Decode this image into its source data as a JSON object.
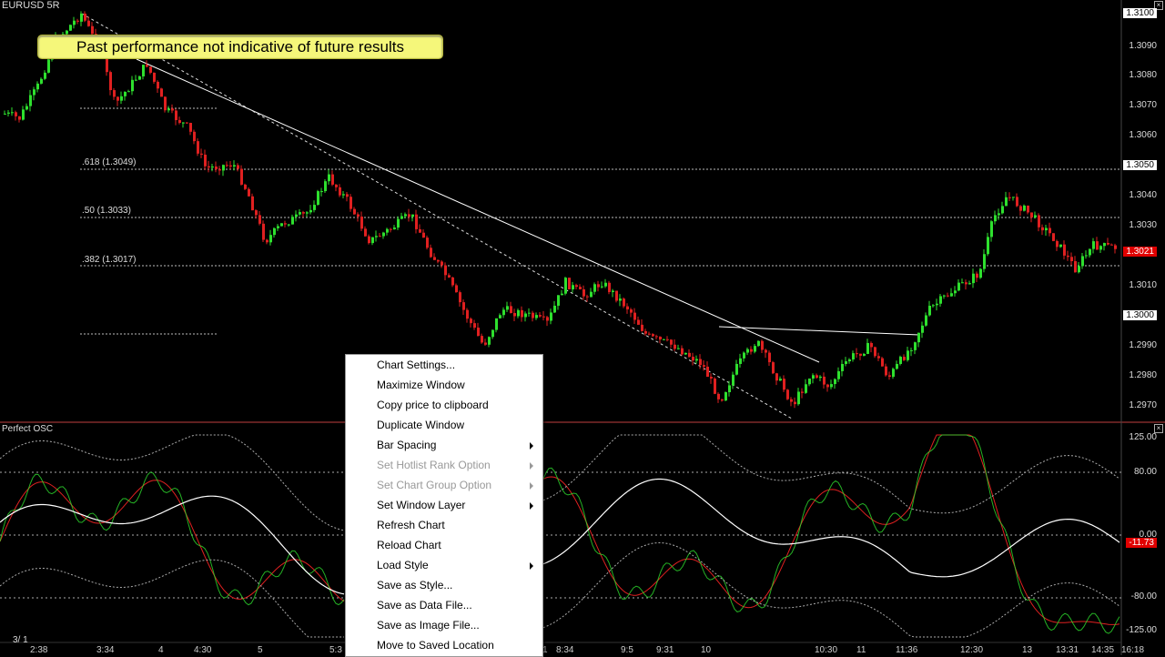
{
  "window": {
    "price_title": "EURUSD 5R",
    "osc_title": "Perfect OSC",
    "page_indicator": "3/ 1"
  },
  "banner": {
    "text": "Past performance not indicative of future results"
  },
  "fib_labels": [
    ".618 (1.3049)",
    ".50 (1.3033)",
    ".382 (1.3017)"
  ],
  "price_axis": [
    "1.3090",
    "1.3080",
    "1.3070",
    "1.3060",
    "1.3040",
    "1.3030",
    "1.3010",
    "1.2990",
    "1.2980",
    "1.2970"
  ],
  "price_boxes": [
    "1.3100",
    "1.3050",
    "1.3000"
  ],
  "last_price": "1.3021",
  "osc_axis": [
    "125.00",
    "80.00",
    "0.00",
    "-80.00",
    "-125.00"
  ],
  "osc_last": "-11.73",
  "time_axis": [
    "2:38",
    "3:34",
    "4",
    "4:30",
    "5",
    "5:3",
    "1",
    "8:34",
    "9:5",
    "9:31",
    "10",
    "10:30",
    "11",
    "11:36",
    "12:30",
    "13",
    "13:31",
    "14:35",
    "16:18"
  ],
  "context_menu": {
    "items": [
      {
        "label": "Chart Settings...",
        "enabled": true,
        "submenu": false
      },
      {
        "label": "Maximize Window",
        "enabled": true,
        "submenu": false
      },
      {
        "label": "Copy price to clipboard",
        "enabled": true,
        "submenu": false
      },
      {
        "label": "Duplicate Window",
        "enabled": true,
        "submenu": false
      },
      {
        "label": "Bar Spacing",
        "enabled": true,
        "submenu": true
      },
      {
        "label": "Set Hotlist Rank Option",
        "enabled": false,
        "submenu": true
      },
      {
        "label": "Set Chart Group Option",
        "enabled": false,
        "submenu": true
      },
      {
        "label": "Set Window Layer",
        "enabled": true,
        "submenu": true
      },
      {
        "label": "Refresh Chart",
        "enabled": true,
        "submenu": false
      },
      {
        "label": "Reload Chart",
        "enabled": true,
        "submenu": false
      },
      {
        "label": "Load Style",
        "enabled": true,
        "submenu": true
      },
      {
        "label": "Save as Style...",
        "enabled": true,
        "submenu": false
      },
      {
        "label": "Save as Data File...",
        "enabled": true,
        "submenu": false
      },
      {
        "label": "Save as  Image File...",
        "enabled": true,
        "submenu": false
      },
      {
        "label": "Move to Saved Location",
        "enabled": true,
        "submenu": false
      }
    ]
  },
  "colors": {
    "up_candle": "#2ee02e",
    "down_candle": "#e02020",
    "banner_bg": "#f5f77a",
    "osc_white": "#ffffff",
    "last_price_box": "#e00000"
  }
}
